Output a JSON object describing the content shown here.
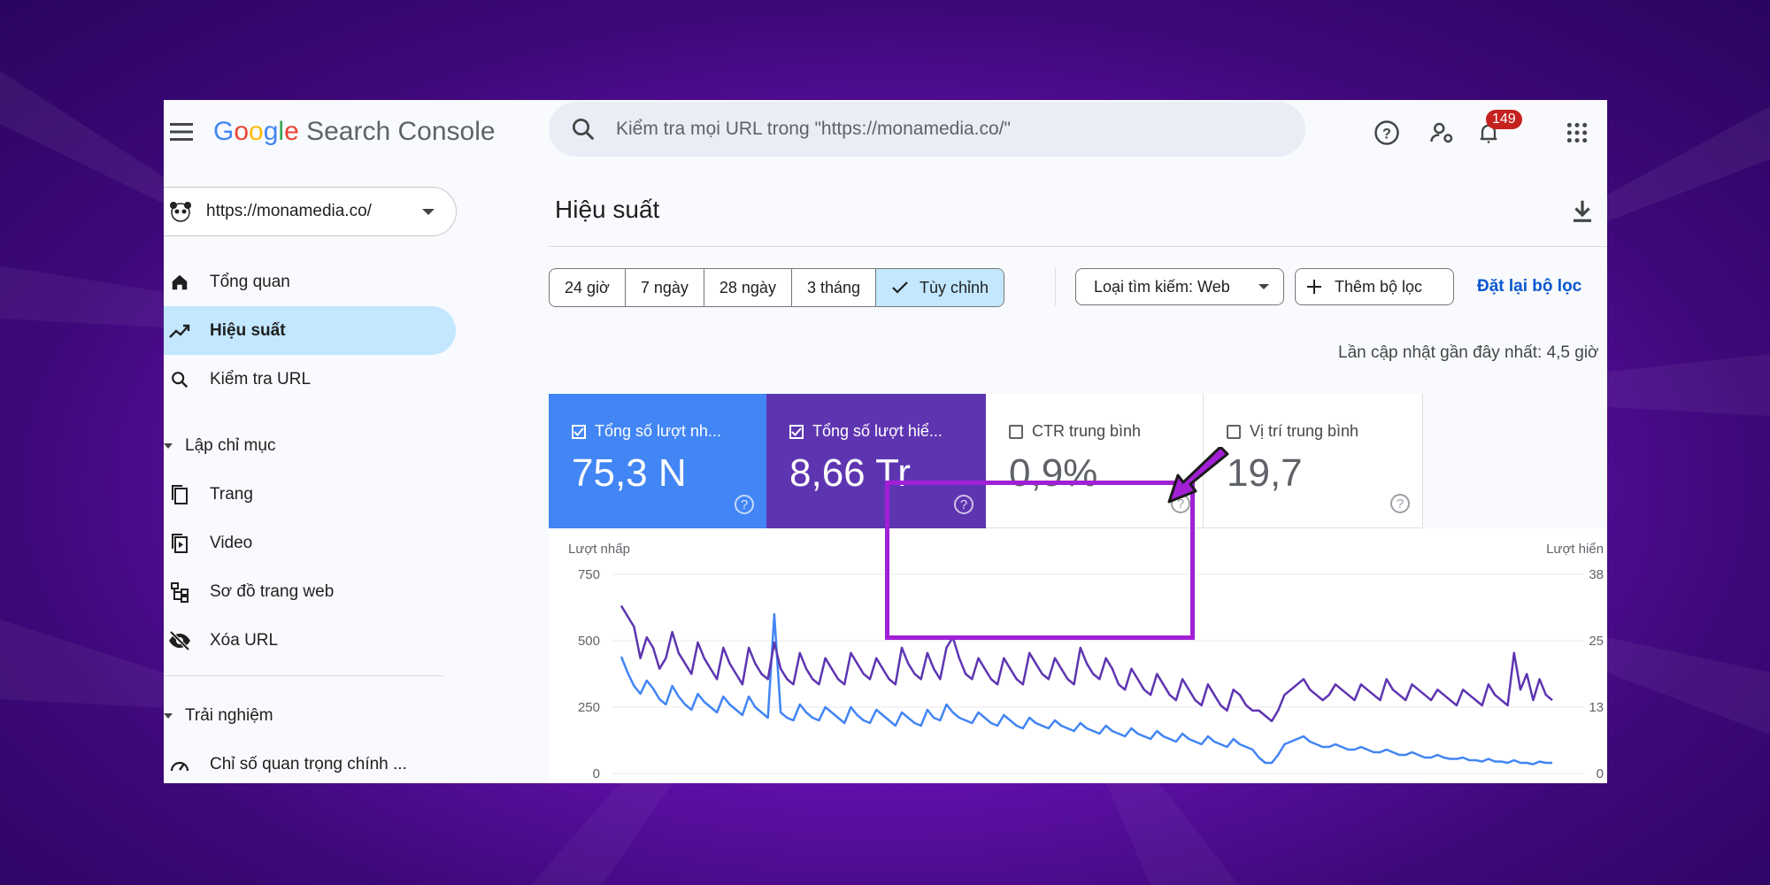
{
  "header": {
    "logo_google": [
      "G",
      "o",
      "o",
      "g",
      "l",
      "e"
    ],
    "logo_product": "Search Console",
    "search_placeholder": "Kiểm tra mọi URL trong \"https://monamedia.co/\"",
    "notification_count": "149"
  },
  "sidebar": {
    "property": "https://monamedia.co/",
    "items": [
      {
        "label": "Tổng quan",
        "icon": "home-icon"
      },
      {
        "label": "Hiệu suất",
        "icon": "trending-up-icon",
        "active": true
      },
      {
        "label": "Kiểm tra URL",
        "icon": "search-icon"
      }
    ],
    "section_index": "Lập chỉ mục",
    "index_items": [
      {
        "label": "Trang",
        "icon": "pages-icon"
      },
      {
        "label": "Video",
        "icon": "video-icon"
      },
      {
        "label": "Sơ đồ trang web",
        "icon": "sitemap-icon"
      },
      {
        "label": "Xóa URL",
        "icon": "visibility-off-icon"
      }
    ],
    "section_experience": "Trải nghiệm",
    "experience_items": [
      {
        "label": "Chỉ số quan trọng chính ...",
        "icon": "speed-icon"
      }
    ]
  },
  "main": {
    "title": "Hiệu suất",
    "date_ranges": [
      "24 giờ",
      "7 ngày",
      "28 ngày",
      "3 tháng",
      "Tùy chỉnh"
    ],
    "selected_range": "Tùy chỉnh",
    "search_type": "Loại tìm kiếm: Web",
    "add_filter": "Thêm bộ lọc",
    "reset_filter": "Đặt lại bộ lọc",
    "last_update": "Lần cập nhật gần đây nhất: 4,5 giờ"
  },
  "metrics": [
    {
      "label": "Tổng số lượt nh...",
      "value": "75,3 N",
      "checked": true,
      "color": "#4285f4"
    },
    {
      "label": "Tổng số lượt hiể...",
      "value": "8,66 Tr",
      "checked": true,
      "color": "#5e35b1"
    },
    {
      "label": "CTR trung bình",
      "value": "0,9%",
      "checked": false,
      "color": "#ffffff"
    },
    {
      "label": "Vị trí trung bình",
      "value": "19,7",
      "checked": false,
      "color": "#ffffff"
    }
  ],
  "chart_data": {
    "type": "line",
    "ylabel_left": "Lượt nhấp",
    "ylabel_right": "Lượt hiển",
    "left_ticks": [
      "750",
      "500",
      "250",
      "0"
    ],
    "right_ticks": [
      "38",
      "25",
      "13",
      "0"
    ],
    "ylim_left": [
      0,
      750
    ],
    "series": [
      {
        "name": "Lượt nhấp",
        "color": "#4285f4",
        "axis": "left",
        "values": [
          440,
          380,
          330,
          300,
          350,
          320,
          280,
          260,
          330,
          290,
          260,
          240,
          300,
          270,
          250,
          230,
          290,
          260,
          240,
          220,
          290,
          250,
          230,
          210,
          600,
          230,
          210,
          200,
          260,
          230,
          210,
          200,
          250,
          230,
          210,
          190,
          250,
          220,
          200,
          190,
          240,
          220,
          200,
          180,
          230,
          210,
          190,
          180,
          240,
          210,
          200,
          260,
          230,
          210,
          200,
          190,
          230,
          210,
          190,
          180,
          220,
          200,
          180,
          170,
          210,
          190,
          180,
          170,
          200,
          180,
          170,
          160,
          190,
          170,
          160,
          150,
          180,
          160,
          150,
          140,
          170,
          150,
          140,
          130,
          160,
          140,
          130,
          120,
          150,
          130,
          120,
          110,
          140,
          120,
          110,
          100,
          130,
          110,
          100,
          90,
          60,
          40,
          40,
          70,
          110,
          120,
          130,
          140,
          120,
          110,
          100,
          100,
          110,
          100,
          90,
          90,
          100,
          90,
          80,
          80,
          90,
          80,
          70,
          70,
          80,
          70,
          60,
          60,
          70,
          60,
          55,
          55,
          60,
          50,
          50,
          45,
          55,
          45,
          45,
          40,
          50,
          40,
          40,
          35,
          45,
          40,
          40
        ]
      },
      {
        "name": "Lượt hiển",
        "color": "#5e35b1",
        "axis": "right",
        "values": [
          32,
          30,
          28,
          22,
          26,
          24,
          20,
          22,
          27,
          23,
          21,
          19,
          25,
          22,
          20,
          18,
          24,
          21,
          19,
          17,
          24,
          21,
          19,
          18,
          25,
          20,
          18,
          17,
          23,
          20,
          18,
          17,
          22,
          20,
          18,
          17,
          23,
          21,
          19,
          18,
          22,
          20,
          18,
          17,
          24,
          21,
          19,
          18,
          23,
          20,
          18,
          24,
          26,
          22,
          19,
          18,
          22,
          20,
          18,
          17,
          22,
          20,
          18,
          17,
          23,
          21,
          19,
          18,
          22,
          20,
          18,
          17,
          24,
          21,
          19,
          18,
          22,
          20,
          17,
          16,
          20,
          18,
          16,
          15,
          19,
          17,
          15,
          14,
          18,
          16,
          14,
          13,
          17,
          15,
          13,
          12,
          16,
          15,
          13,
          12,
          12,
          11,
          10,
          12,
          15,
          16,
          17,
          18,
          16,
          15,
          14,
          15,
          17,
          16,
          15,
          14,
          17,
          16,
          15,
          14,
          18,
          16,
          15,
          14,
          17,
          16,
          15,
          14,
          16,
          15,
          14,
          13,
          16,
          15,
          14,
          13,
          17,
          15,
          14,
          13,
          23,
          16,
          19,
          14,
          18,
          15,
          14
        ]
      }
    ]
  }
}
